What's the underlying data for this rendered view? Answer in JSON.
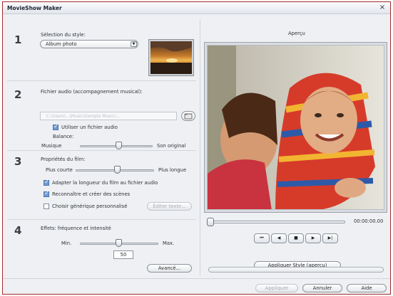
{
  "window": {
    "title": "MovieShow Maker",
    "close_glyph": "×"
  },
  "step1": {
    "number": "1",
    "label": "Sélection du style:",
    "style_value": "Album photo"
  },
  "step2": {
    "number": "2",
    "label": "Fichier audio (accompagnement musical):",
    "file_placeholder": "C:\\Users\\...\\Music\\Sample Music\\...",
    "use_audio_label": "Utiliser un fichier audio",
    "use_audio_checked": true,
    "balance_label": "Balance:",
    "balance_left": "Musique",
    "balance_right": "Son original",
    "balance_value": 0.55
  },
  "step3": {
    "number": "3",
    "label": "Propriétés du film:",
    "length_left": "Plus courte",
    "length_right": "Plus longue",
    "length_value": 0.55,
    "adapt_label": "Adapter la longueur du film au fichier audio",
    "adapt_checked": true,
    "scenes_label": "Reconnaître et créer des scènes",
    "scenes_checked": true,
    "credits_label": "Choisir générique personnalisé",
    "credits_checked": false,
    "edit_text_label": "Éditer texte..."
  },
  "step4": {
    "number": "4",
    "label": "Effets: fréquence et intensité",
    "min_label": "Min.",
    "max_label": "Max.",
    "effect_value": 0.5,
    "spin_value": "50",
    "advanced_label": "Avancé..."
  },
  "preview": {
    "label": "Aperçu",
    "timecode": "00:00:00.00",
    "position": 0.0,
    "apply_label": "Appliquer Style (aperçu)",
    "controls": [
      "⏮",
      "◀",
      "■",
      "▶",
      "▶|"
    ]
  },
  "footer": {
    "apply_label": "Appliquer",
    "cancel_label": "Annuler",
    "help_label": "Aide"
  },
  "colors": {
    "window_border": "#a12a2a",
    "check_fill": "#6f9bd2",
    "panel_bg": "#eef0f3"
  }
}
